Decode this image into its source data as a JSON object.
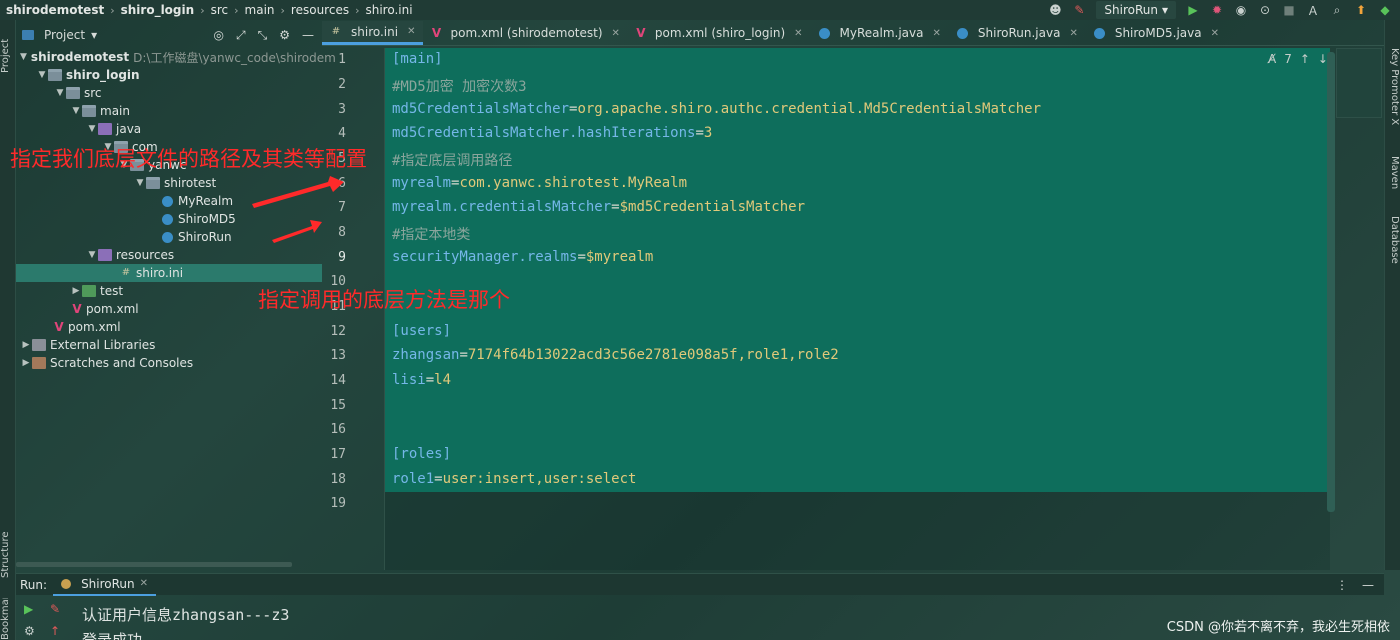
{
  "breadcrumb": [
    "shirodemotest",
    "shiro_login",
    "src",
    "main",
    "resources",
    "shiro.ini"
  ],
  "run_config": "ShiroRun",
  "left_tabs": {
    "project": "Project",
    "structure": "Structure",
    "bookmarks": "Bookmarks"
  },
  "right_tabs": {
    "key_promoter": "Key Promoter X",
    "maven": "Maven",
    "database": "Database"
  },
  "project": {
    "label": "Project",
    "items": [
      {
        "label": "shirodemotest",
        "path": "D:\\工作磁盘\\yanwc_code\\shirodem"
      },
      {
        "label": "shiro_login"
      },
      {
        "label": "src"
      },
      {
        "label": "main"
      },
      {
        "label": "java"
      },
      {
        "label": "com"
      },
      {
        "label": "yanwc"
      },
      {
        "label": "shirotest"
      },
      {
        "label": "MyRealm"
      },
      {
        "label": "ShiroMD5"
      },
      {
        "label": "ShiroRun"
      },
      {
        "label": "resources"
      },
      {
        "label": "shiro.ini"
      },
      {
        "label": "test"
      },
      {
        "label": "pom.xml"
      },
      {
        "label": "pom.xml"
      },
      {
        "label": "External Libraries"
      },
      {
        "label": "Scratches and Consoles"
      }
    ]
  },
  "tabs": [
    {
      "label": "shiro.ini"
    },
    {
      "label": "pom.xml (shirodemotest)"
    },
    {
      "label": "pom.xml (shiro_login)"
    },
    {
      "label": "MyRealm.java"
    },
    {
      "label": "ShiroRun.java"
    },
    {
      "label": "ShiroMD5.java"
    }
  ],
  "inspection_count": "7",
  "line_numbers": [
    "1",
    "2",
    "3",
    "4",
    "5",
    "6",
    "7",
    "8",
    "9",
    "10",
    "11",
    "12",
    "13",
    "14",
    "15",
    "16",
    "17",
    "18",
    "19"
  ],
  "code": {
    "l1": "[main]",
    "l2": "#MD5加密 加密次数3",
    "l3k": "md5CredentialsMatcher",
    "l3v": "org.apache.shiro.authc.credential.Md5CredentialsMatcher",
    "l4k": "md5CredentialsMatcher.hashIterations",
    "l4v": "3",
    "l5": "#指定底层调用路径",
    "l6k": "myrealm",
    "l6v": "com.yanwc.shirotest.MyRealm",
    "l7k": "myrealm.credentialsMatcher",
    "l7v": "$md5CredentialsMatcher",
    "l8": "#指定本地类",
    "l9k": "securityManager.realms",
    "l9v": "$myrealm",
    "l12": "[users]",
    "l13k": "zhangsan",
    "l13v": "7174f64b13022acd3c56e2781e098a5f,role1,role2",
    "l14k": "lisi",
    "l14v": "l4",
    "l17": "[roles]",
    "l18k": "role1",
    "l18v": "user:insert,user:select"
  },
  "annotations": {
    "a1": "指定我们底层文件的路径及其类等配置",
    "a2": "指定调用的底层方法是那个"
  },
  "run": {
    "label": "Run:",
    "tab": "ShiroRun"
  },
  "console": [
    "认证用户信息zhangsan---z3",
    "登录成功"
  ],
  "watermark": "CSDN @你若不离不弃，我必生死相依",
  "colors": {
    "editor_bg": "#0e6e5c",
    "annotation": "#ff2a2a",
    "selection": "#2b7a6c"
  }
}
